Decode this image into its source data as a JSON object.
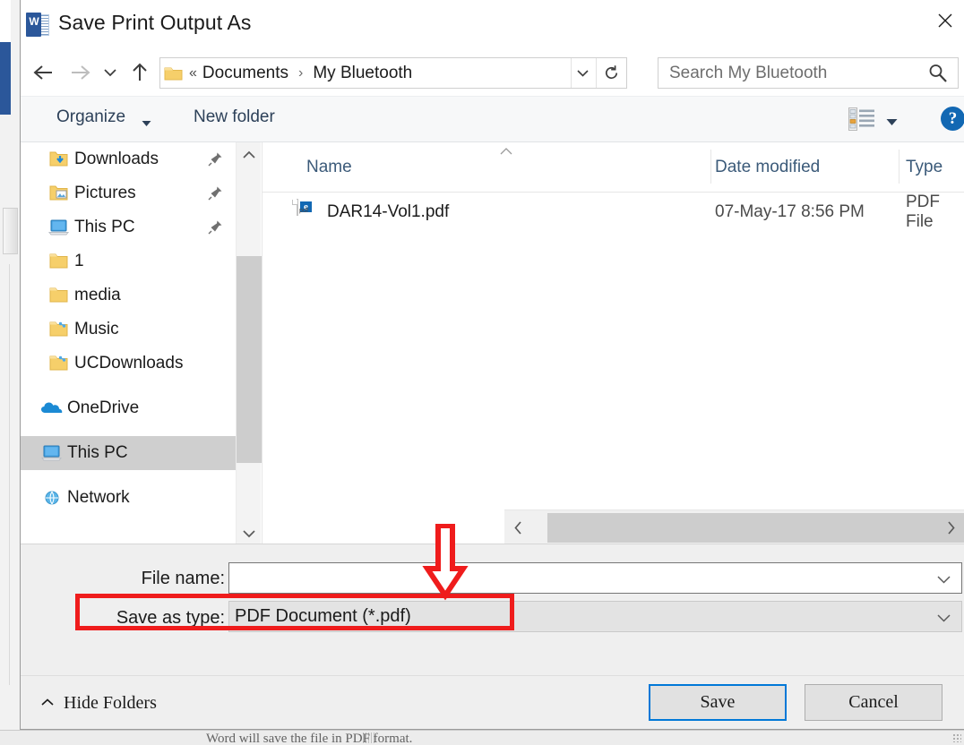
{
  "window": {
    "title": "Save Print Output As",
    "app_icon": "word-icon",
    "close_label": "✕"
  },
  "nav": {
    "back": "back-arrow",
    "forward": "forward-arrow",
    "recent": "recent-locations-chevron",
    "up": "up-arrow",
    "address": {
      "folder_icon": "folder-icon",
      "overflow": "«",
      "crumbs": [
        "Documents",
        "My Bluetooth"
      ],
      "separator": "›",
      "dropdown": "chevron-down-icon",
      "refresh": "refresh-icon"
    },
    "search": {
      "placeholder": "Search My Bluetooth",
      "icon": "search-icon"
    }
  },
  "toolbar": {
    "organize": "Organize",
    "organize_caret": "▾",
    "new_folder": "New folder",
    "view_icon": "view-layout-icon",
    "view_caret": "▾",
    "help": "?"
  },
  "sidebar": {
    "items": [
      {
        "label": "Downloads",
        "icon": "downloads-folder-icon",
        "pinned": true,
        "indent": true,
        "selected": false
      },
      {
        "label": "Pictures",
        "icon": "pictures-folder-icon",
        "pinned": true,
        "indent": true,
        "selected": false
      },
      {
        "label": "This PC",
        "icon": "this-pc-icon",
        "pinned": true,
        "indent": true,
        "selected": false
      },
      {
        "label": "1",
        "icon": "folder-icon",
        "pinned": false,
        "indent": true,
        "selected": false
      },
      {
        "label": "media",
        "icon": "folder-icon",
        "pinned": false,
        "indent": true,
        "selected": false
      },
      {
        "label": "Music",
        "icon": "shared-folder-icon",
        "pinned": false,
        "indent": true,
        "selected": false
      },
      {
        "label": "UCDownloads",
        "icon": "shared-folder-icon",
        "pinned": false,
        "indent": true,
        "selected": false
      },
      {
        "label": "OneDrive",
        "icon": "onedrive-cloud-icon",
        "pinned": false,
        "indent": false,
        "selected": false
      },
      {
        "label": "This PC",
        "icon": "this-pc-icon",
        "pinned": false,
        "indent": false,
        "selected": true
      },
      {
        "label": "Network",
        "icon": "network-icon",
        "pinned": false,
        "indent": false,
        "selected": false
      }
    ],
    "scroll_up": "chevron-up-icon",
    "scroll_down": "chevron-down-icon"
  },
  "filelist": {
    "columns": [
      "Name",
      "Date modified",
      "Type"
    ],
    "sort_indicator": "sort-ascending-icon",
    "rows": [
      {
        "name": "DAR14-Vol1.pdf",
        "icon": "pdf-file-icon",
        "icon_badge": "e",
        "icon_label": "pdf",
        "date": "07-May-17 8:56 PM",
        "type": "PDF File"
      }
    ],
    "hscroll_left": "chevron-left-icon",
    "hscroll_right": "chevron-right-icon"
  },
  "form": {
    "file_name_label": "File name:",
    "file_name_value": "",
    "save_type_label": "Save as type:",
    "save_type_value": "PDF Document (*.pdf)",
    "dropdown_icon": "chevron-down-icon"
  },
  "footer": {
    "hide_folders": "Hide Folders",
    "hide_folders_icon": "chevron-up-icon",
    "save": "Save",
    "cancel": "Cancel"
  },
  "annotations": {
    "highlight_color": "#ef1c1c",
    "rect_target": "save-as-type-row",
    "arrow_target": "save-as-type-row"
  },
  "background": {
    "obscured_text": "Word will save the file in PDF format."
  }
}
